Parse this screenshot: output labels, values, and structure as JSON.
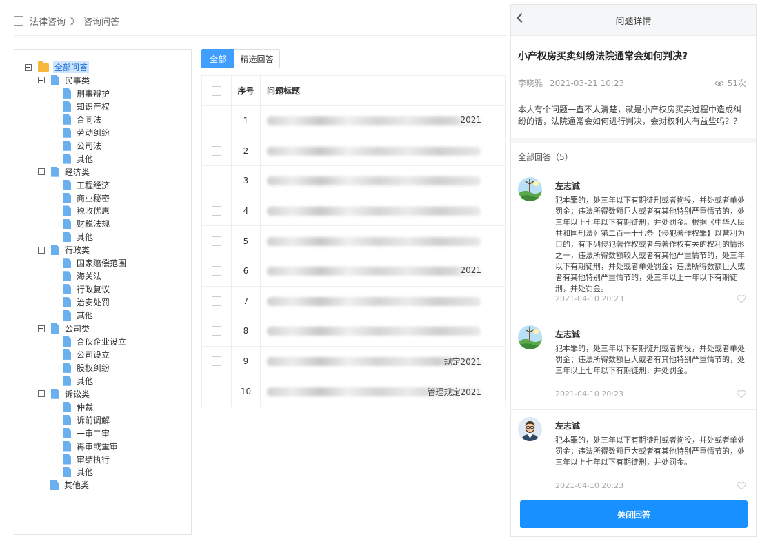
{
  "breadcrumb": {
    "root": "法律咨询",
    "separator": "》",
    "current": "咨询问答"
  },
  "tree": {
    "root": "全部问答",
    "groups": [
      {
        "label": "民事类",
        "children": [
          "刑事辩护",
          "知识产权",
          "合同法",
          "劳动纠纷",
          "公司法",
          "其他"
        ]
      },
      {
        "label": "经济类",
        "children": [
          "工程经济",
          "商业秘密",
          "税收优惠",
          "财税法规",
          "其他"
        ]
      },
      {
        "label": "行政类",
        "children": [
          "国家赔偿范围",
          "海关法",
          "行政复议",
          "治安处罚",
          "其他"
        ]
      },
      {
        "label": "公司类",
        "children": [
          "合伙企业设立",
          "公司设立",
          "股权纠纷",
          "其他"
        ]
      },
      {
        "label": "诉讼类",
        "children": [
          "仲裁",
          "诉前调解",
          "一审二审",
          "再审或重审",
          "审结执行",
          "其他"
        ]
      }
    ],
    "last": "其他类"
  },
  "tabs": [
    {
      "label": "全部"
    },
    {
      "label": "精选回答"
    }
  ],
  "table": {
    "headers": {
      "index": "序号",
      "title": "问题标题"
    },
    "rows": [
      {
        "index": "1",
        "tail": "2021"
      },
      {
        "index": "2",
        "tail": ""
      },
      {
        "index": "3",
        "tail": ""
      },
      {
        "index": "4",
        "tail": ""
      },
      {
        "index": "5",
        "tail": ""
      },
      {
        "index": "6",
        "tail": "2021"
      },
      {
        "index": "7",
        "tail": ""
      },
      {
        "index": "8",
        "tail": ""
      },
      {
        "index": "9",
        "tail": "规定2021"
      },
      {
        "index": "10",
        "tail": "管理规定2021"
      }
    ]
  },
  "detail": {
    "header_title": "问题详情",
    "question_title": "小产权房买卖纠纷法院通常会如何判决?",
    "author": "李晓雅",
    "time": "2021-03-21 10:23",
    "views": "51次",
    "body": "本人有个问题一直不太清楚，就是小产权房买卖过程中造成纠纷的话，法院通常会如何进行判决，会对权利人有益些吗？？",
    "answers_header": "全部回答（5）",
    "answers": [
      {
        "name": "左志诚",
        "text": "犯本罪的，处三年以下有期徒刑或者拘役，并处或者单处罚金；违法所得数额巨大或者有其他特别严重情节的，处三年以上七年以下有期徒刑，并处罚金。根据《中华人民共和国刑法》第二百一十七条【侵犯著作权罪】以营利为目的，有下列侵犯著作权或者与著作权有关的权利的情形之一，违法所得数额较大或者有其他严重情节的，处三年以下有期徒刑，并处或者单处罚金；违法所得数额巨大或者有其他特别严重情节的，处三年以上十年以下有期徒刑，并处罚金。",
        "date": "2021-04-10  20:23",
        "avatar": "landscape"
      },
      {
        "name": "左志诚",
        "text": "犯本罪的，处三年以下有期徒刑或者拘役，并处或者单处罚金；违法所得数额巨大或者有其他特别严重情节的，处三年以上七年以下有期徒刑，并处罚金。",
        "date": "2021-04-10  20:23",
        "avatar": "landscape"
      },
      {
        "name": "左志诚",
        "text": "犯本罪的，处三年以下有期徒刑或者拘役，并处或者单处罚金；违法所得数额巨大或者有其他特别严重情节的，处三年以上七年以下有期徒刑，并处罚金。",
        "date": "2021-04-10  20:23",
        "avatar": "man"
      }
    ],
    "close_button": "关闭回答"
  },
  "colors": {
    "primary": "#409eff",
    "button": "#1890ff",
    "folder": "#f6b73c",
    "file": "#6ab0ef"
  }
}
